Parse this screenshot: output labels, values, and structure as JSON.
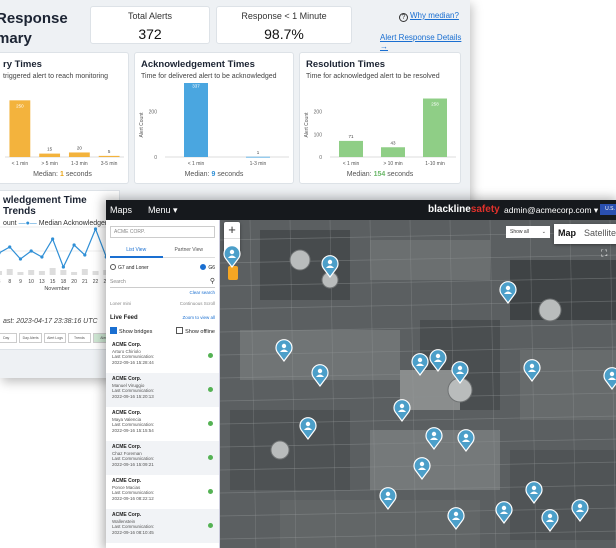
{
  "dashboard": {
    "title_line1": "Response",
    "title_line2": "mary",
    "kpis": [
      {
        "label": "Total Alerts",
        "value": "372"
      },
      {
        "label": "Response < 1 Minute",
        "value": "98.7%"
      }
    ],
    "why_median": "Why median?",
    "details_link": "Alert Response Details",
    "cards": [
      {
        "title": "ry Times",
        "subtitle": "triggered alert to reach monitoring",
        "median_label": "Median:",
        "median_value": "1",
        "median_unit": "seconds",
        "color": "#f3b33d",
        "y_axis_label": "",
        "ticks": [],
        "bars": [
          {
            "category": "< 1 min",
            "value": 250,
            "label": "250"
          },
          {
            "category": "> 5 min",
            "value": 15,
            "label": "15"
          },
          {
            "category": "1-3 min",
            "value": 20,
            "label": "20"
          },
          {
            "category": "3-5 min",
            "value": 5,
            "label": "5"
          }
        ]
      },
      {
        "title": "Acknowledgement Times",
        "subtitle": "Time for delivered alert to be acknowledged",
        "median_label": "Median:",
        "median_value": "9",
        "median_unit": "seconds",
        "color": "#4aa6e0",
        "y_axis_label": "Alert Count",
        "ticks": [
          "200",
          "0"
        ],
        "bars": [
          {
            "category": "< 1 min",
            "value": 337,
            "label": "337"
          },
          {
            "category": "1-3 min",
            "value": 1,
            "label": "1"
          }
        ]
      },
      {
        "title": "Resolution Times",
        "subtitle": "Time for acknowledged alert to be resolved",
        "median_label": "Median:",
        "median_value": "154",
        "median_unit": "seconds",
        "color": "#8fce86",
        "y_axis_label": "Alert Count",
        "ticks": [
          "200",
          "100",
          "0"
        ],
        "bars": [
          {
            "category": "< 1 min",
            "value": 71,
            "label": "71"
          },
          {
            "category": "> 10 min",
            "value": 43,
            "label": "43"
          },
          {
            "category": "1-10 min",
            "value": 258,
            "label": "258"
          }
        ]
      }
    ],
    "trend": {
      "title": "wledgement Time Trends",
      "legend_prefix": "ount",
      "legend_line": "Median Acknowledgement",
      "x_ticks": [
        "3",
        "8",
        "9",
        "10",
        "13",
        "15",
        "18",
        "20",
        "21",
        "22",
        "23",
        "2"
      ],
      "x_label": "November",
      "last_updated": "ast: 2023-04-17 23:38:16 UTC",
      "tabs": [
        "Day",
        "Day Alerts",
        "Alert Logs",
        "Trends",
        "Alert Response Time"
      ]
    }
  },
  "map_app": {
    "nav_maps": "Maps",
    "nav_menu": "Menu ▾",
    "brand_main": "blackline",
    "brand_accent": "safety",
    "user_email": "admin@acmecorp.com ▾",
    "flag_label": "U.S.",
    "sidebar": {
      "company": "ACME CORP.",
      "views": [
        "List View",
        "Partner View"
      ],
      "radios": [
        "G7 and Loner",
        "G6"
      ],
      "search_placeholder": "Search",
      "clear_search": "Clear search",
      "modes": [
        "Loner mini",
        "Continuous Scroll"
      ],
      "live_feed": "Live Feed",
      "zoom_link": "Zoom to view all",
      "show_bridges": "Show bridges",
      "show_offline": "Show offline",
      "devices": [
        {
          "company": "ACME Corp.",
          "name": "Arturo Chiriolo",
          "comm_label": "Last Communication:",
          "time": "2022-09-16 15:28:44"
        },
        {
          "company": "ACME Corp.",
          "name": "Manuel Viruggio",
          "comm_label": "Last Communication:",
          "time": "2022-09-16 15:20:13"
        },
        {
          "company": "ACME Corp.",
          "name": "Maya Valencia",
          "comm_label": "Last Communication:",
          "time": "2022-09-16 15:15:54"
        },
        {
          "company": "ACME Corp.",
          "name": "Chaz Foreman",
          "comm_label": "Last Communication:",
          "time": "2022-09-16 15:09:21"
        },
        {
          "company": "ACME Corp.",
          "name": "Ponce Macias",
          "comm_label": "Last Communication:",
          "time": "2022-09-16 08:22:12"
        },
        {
          "company": "ACME Corp.",
          "name": "Wallenstein",
          "comm_label": "Last Communication:",
          "time": "2022-09-16 08:10:45"
        }
      ]
    },
    "map": {
      "show_all": "Show all",
      "map_type": [
        "Map",
        "Satellite"
      ],
      "zoom_in": "+",
      "zoom_out": "−",
      "pin_color": "#4c9fc9"
    }
  }
}
